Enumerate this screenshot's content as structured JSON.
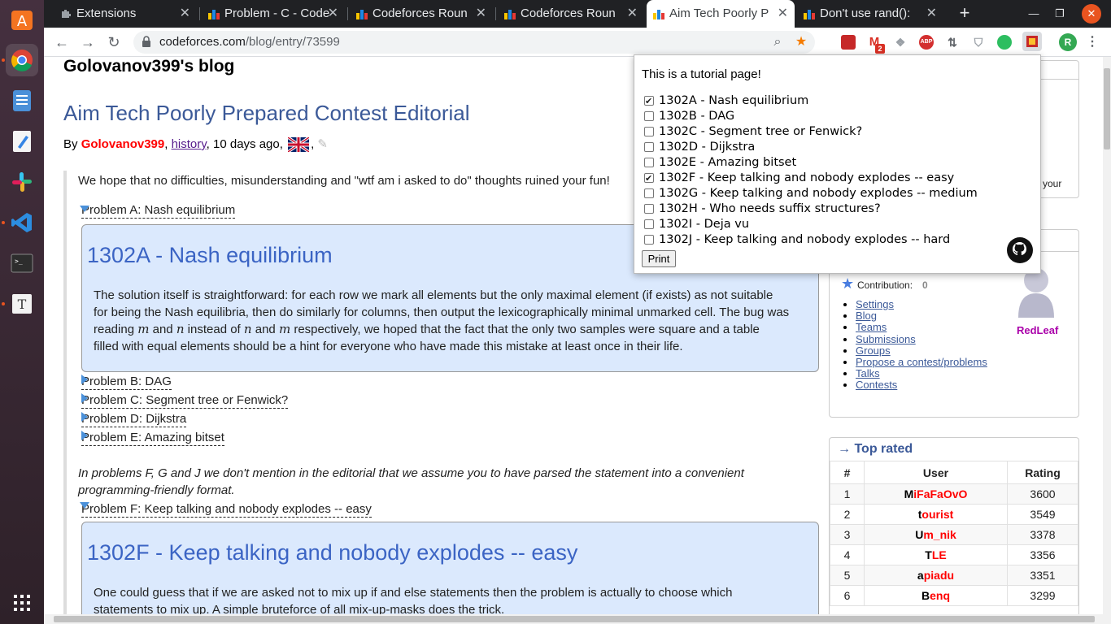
{
  "tabs": [
    {
      "title": "Extensions",
      "active": false
    },
    {
      "title": "Problem - C - Code",
      "active": false
    },
    {
      "title": "Codeforces Roun",
      "active": false
    },
    {
      "title": "Codeforces Roun",
      "active": false
    },
    {
      "title": "Aim Tech Poorly P",
      "active": true
    },
    {
      "title": "Don't use rand():",
      "active": false
    }
  ],
  "omnibox": {
    "domain": "codeforces.com",
    "path": "/blog/entry/73599"
  },
  "extensions": {
    "gmail_badge": "2",
    "abp": "ABP"
  },
  "profile_initial": "R",
  "page": {
    "blog_title": "Golovanov399's blog",
    "entry_title": "Aim Tech Poorly Prepared Contest Editorial",
    "byline": {
      "by": "By",
      "author": "Golovanov399",
      "history": "history",
      "ago": "10 days ago,"
    },
    "intro": "We hope that no difficulties, misunderstanding and \"wtf am i asked to do\" thoughts ruined your fun!",
    "spoiler_a_title": "Problem A: Nash equilibrium",
    "box_a": {
      "heading": "1302A - Nash equilibrium",
      "line1": "The solution itself is straightforward: for each row we mark all elements but the only maximal element (if exists) as not suitable",
      "line2": "for being the Nash equilibria, then do similarly for columns, then output the lexicographically minimal unmarked cell. The bug was",
      "line3_a": "reading",
      "m": "m",
      "and": "and",
      "n": "n",
      "line3_b": "instead of",
      "line3_c": "respectively, we hoped that the fact that the only two samples were square and a table",
      "line4": "filled with equal elements should be a hint for everyone who have made this mistake at least once in their life."
    },
    "spoilers_collapsed": [
      "Problem B: DAG",
      "Problem C: Segment tree or Fenwick?",
      "Problem D: Dijkstra",
      "Problem E: Amazing bitset"
    ],
    "note_line1": "In problems F, G and J we don't mention in the editorial that we assume you to have parsed the statement into a convenient",
    "note_line2": "programming-friendly format.",
    "spoiler_f_title": "Problem F: Keep talking and nobody explodes -- easy",
    "box_f": {
      "heading": "1302F - Keep talking and nobody explodes -- easy",
      "line1": "One could guess that if we are asked not to mix up if and else statements then the problem is actually to choose which",
      "line2": "statements to mix up. A simple bruteforce of all mix-up-masks does the trick."
    }
  },
  "sidebar": {
    "partial_text": "your",
    "contribution_label": "Contribution:",
    "contribution_value": "0",
    "username": "RedLeaf",
    "links": [
      "Settings",
      "Blog",
      "Teams",
      "Submissions",
      "Groups",
      "Propose a contest/problems",
      "Talks",
      "Contests"
    ],
    "top_rated": {
      "arrow": "→",
      "title": "Top rated",
      "headers": [
        "#",
        "User",
        "Rating"
      ],
      "rows": [
        {
          "rank": "1",
          "first": "M",
          "rest": "iFaFaOvO",
          "rating": "3600"
        },
        {
          "rank": "2",
          "first": "t",
          "rest": "ourist",
          "rating": "3549"
        },
        {
          "rank": "3",
          "first": "U",
          "rest": "m_nik",
          "rating": "3378"
        },
        {
          "rank": "4",
          "first": "T",
          "rest": "LE",
          "rating": "3356"
        },
        {
          "rank": "5",
          "first": "a",
          "rest": "piadu",
          "rating": "3351"
        },
        {
          "rank": "6",
          "first": "B",
          "rest": "enq",
          "rating": "3299"
        }
      ]
    }
  },
  "popup": {
    "heading": "This is a tutorial page!",
    "items": [
      {
        "label": "1302A - Nash equilibrium",
        "checked": true
      },
      {
        "label": "1302B - DAG",
        "checked": false
      },
      {
        "label": "1302C - Segment tree or Fenwick?",
        "checked": false
      },
      {
        "label": "1302D - Dijkstra",
        "checked": false
      },
      {
        "label": "1302E - Amazing bitset",
        "checked": false
      },
      {
        "label": "1302F - Keep talking and nobody explodes -- easy",
        "checked": true
      },
      {
        "label": "1302G - Keep talking and nobody explodes -- medium",
        "checked": false
      },
      {
        "label": "1302H - Who needs suffix structures?",
        "checked": false
      },
      {
        "label": "1302I - Deja vu",
        "checked": false
      },
      {
        "label": "1302J - Keep talking and nobody explodes -- hard",
        "checked": false
      }
    ],
    "print_label": "Print"
  },
  "colors": {
    "accent": "#3b5998",
    "spoiler_bg": "#dbe9fd",
    "author_red": "#ff0000"
  }
}
